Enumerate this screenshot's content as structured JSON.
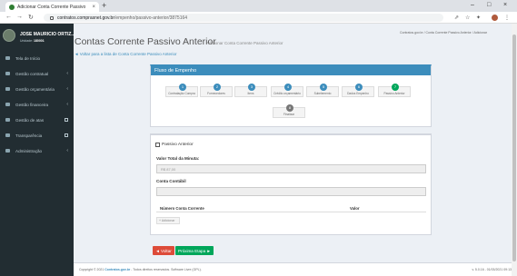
{
  "browser": {
    "tab_title": "Adicionar Conta Corrente Passivo",
    "url_host": "contratos.comprasnet.gov.br",
    "url_path": "/empenho/passivo-anterior/3875164"
  },
  "sidebar": {
    "user_name": "JOSE MAURICIO ORTIZ...",
    "user_role_label": "Unidade:",
    "user_role_value": "180001",
    "items": [
      {
        "label": "Tela de Início",
        "icon": "home-icon",
        "chevron": false,
        "external": false
      },
      {
        "label": "Gestão contratual",
        "icon": "folder-icon",
        "chevron": true,
        "external": false
      },
      {
        "label": "Gestão orçamentária",
        "icon": "money-icon",
        "chevron": true,
        "external": false
      },
      {
        "label": "Gestão financeira",
        "icon": "money-icon",
        "chevron": true,
        "external": false
      },
      {
        "label": "Gestão de atas",
        "icon": "list-icon",
        "chevron": false,
        "external": true
      },
      {
        "label": "Transparência",
        "icon": "eye-icon",
        "chevron": false,
        "external": true
      },
      {
        "label": "Administração",
        "icon": "cog-icon",
        "chevron": true,
        "external": false
      }
    ]
  },
  "page": {
    "title": "Contas Corrente Passivo Anterior",
    "subtitle": "Adicionar Conta Corrente Passivo Anterior",
    "breadcrumb": "Contratos.gov.br  /  Conta Corrente Passivo Anterior  /  Adicionar",
    "back_link": "◄ Voltar para a lista de Conta Corrente Passivo Anterior"
  },
  "flow": {
    "title": "Fluxo de Empenho",
    "steps": [
      {
        "num": "1",
        "label": "Contratação Compra",
        "status": "done"
      },
      {
        "num": "2",
        "label": "Fornecedores",
        "status": "done"
      },
      {
        "num": "3",
        "label": "Itens",
        "status": "done"
      },
      {
        "num": "4",
        "label": "Crédito orçamentário",
        "status": "done"
      },
      {
        "num": "5",
        "label": "Subelemento",
        "status": "done"
      },
      {
        "num": "6",
        "label": "Dados Empenho",
        "status": "done"
      },
      {
        "num": "7",
        "label": "Passivo Anterior",
        "status": "active"
      },
      {
        "num": "8",
        "label": "Finalizar",
        "status": "pending"
      }
    ]
  },
  "form": {
    "checkbox_label": "Passivo Anterior",
    "valor_label": "Valor Total da Minuta:",
    "valor_value": "R$ 87,00",
    "conta_label": "Conta Contábil",
    "conta_value": "",
    "col_numero": "Número Conta Corrente",
    "col_valor": "Valor",
    "add_button": "+ Adicionar",
    "back_button": "◄ Voltar",
    "next_button": "Próxima Etapa ►"
  },
  "footer": {
    "left_prefix": "Copyright © 2021",
    "left_link": "Contratos.gov.br",
    "left_suffix": " - Todos direitos reservados. Software Livre (GPL).",
    "right": "v. 5.0.16 - 01/03/2021 09:13"
  },
  "colors": {
    "primary": "#3c8dbc",
    "success": "#00a65a",
    "danger": "#dd4b39",
    "sidebar": "#222d32"
  }
}
